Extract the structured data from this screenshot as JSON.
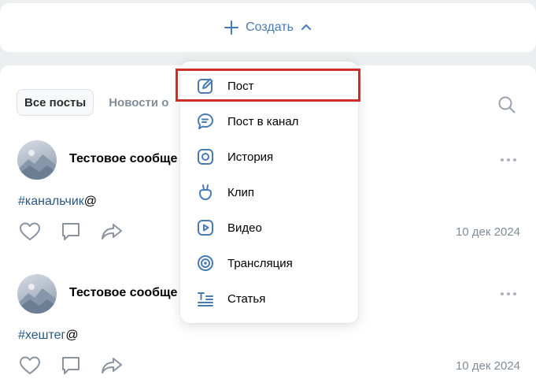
{
  "create_button": {
    "label": "Создать"
  },
  "tabs": [
    {
      "label": "Все посты"
    },
    {
      "label": "Новости о"
    }
  ],
  "posts": [
    {
      "author": "Тестовое сообще",
      "hashtag": "#канальчик",
      "suffix": "@",
      "date": "10 дек 2024"
    },
    {
      "author": "Тестовое сообще",
      "hashtag": "#хештег",
      "suffix": "@",
      "date": "10 дек 2024"
    }
  ],
  "menu": {
    "items": [
      {
        "label": "Пост",
        "icon": "edit-icon"
      },
      {
        "label": "Пост в канал",
        "icon": "chat-bubble-icon"
      },
      {
        "label": "История",
        "icon": "story-icon"
      },
      {
        "label": "Клип",
        "icon": "clip-icon"
      },
      {
        "label": "Видео",
        "icon": "video-icon"
      },
      {
        "label": "Трансляция",
        "icon": "broadcast-icon"
      },
      {
        "label": "Статья",
        "icon": "article-icon"
      }
    ]
  },
  "colors": {
    "icon_blue": "#4a7ab3",
    "highlight_red": "#d32a2a",
    "muted": "#818c99"
  }
}
